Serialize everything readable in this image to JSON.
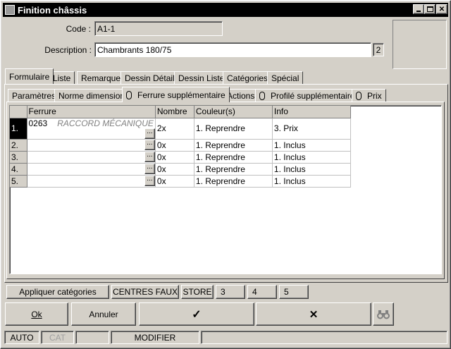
{
  "window": {
    "title": "Finition châssis"
  },
  "form": {
    "code_label": "Code :",
    "code_value": "A1-1",
    "description_label": "Description :",
    "description_value": "Chambrants 180/75",
    "description_count": "2"
  },
  "tabs": [
    "Formulaire",
    "Liste",
    "Remarque",
    "Dessin Détail",
    "Dessin Liste",
    "Catégories",
    "Spécial"
  ],
  "subtabs": [
    "Paramètres",
    "Norme dimensions",
    "Ferrure supplémentaire",
    "Actions",
    "Profilé supplémentaire",
    "Prix"
  ],
  "table": {
    "headers": [
      "Ferrure",
      "Nombre",
      "Couleur(s)",
      "Info"
    ],
    "rows": [
      {
        "num": "1.",
        "ferrure": "0263",
        "hint": "RACCORD MÉCANIQUE",
        "nombre": "2x",
        "couleur": "1. Reprendre",
        "info": "3. Prix"
      },
      {
        "num": "2.",
        "ferrure": "",
        "hint": "",
        "nombre": "0x",
        "couleur": "1. Reprendre",
        "info": "1. Inclus"
      },
      {
        "num": "3.",
        "ferrure": "",
        "hint": "",
        "nombre": "0x",
        "couleur": "1. Reprendre",
        "info": "1. Inclus"
      },
      {
        "num": "4.",
        "ferrure": "",
        "hint": "",
        "nombre": "0x",
        "couleur": "1. Reprendre",
        "info": "1. Inclus"
      },
      {
        "num": "5.",
        "ferrure": "",
        "hint": "",
        "nombre": "0x",
        "couleur": "1. Reprendre",
        "info": "1. Inclus"
      }
    ],
    "ellipsis": "..."
  },
  "bottom_buttons": {
    "apply": "Appliquer catégories",
    "centres": "CENTRES FAUX",
    "store": "STORE",
    "b3": "3",
    "b4": "4",
    "b5": "5"
  },
  "actions": {
    "ok": "Ok",
    "cancel": "Annuler",
    "confirm": "✓",
    "delete": "✕"
  },
  "statusbar": {
    "auto": "AUTO",
    "cat": "CAT",
    "mode": "MODIFIER"
  },
  "icons": [
    "app-icon",
    "minimize-icon",
    "maximize-icon",
    "close-icon",
    "paperclip-icon",
    "binoculars-icon",
    "check-icon",
    "x-icon"
  ]
}
